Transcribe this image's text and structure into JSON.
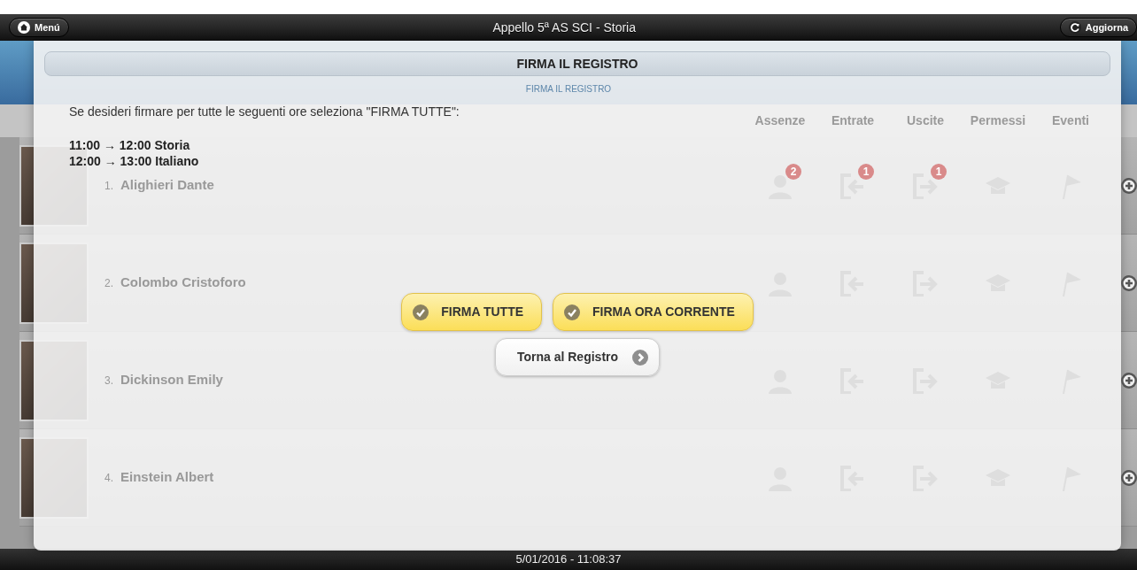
{
  "header": {
    "menu_button": "Menú",
    "title": "Appello 5ª AS SCI - Storia",
    "refresh_button": "Aggiorna"
  },
  "subtitle": "FIRMA IL REGISTRO",
  "columns": [
    "Assenze",
    "Entrate",
    "Uscite",
    "Permessi",
    "Eventi"
  ],
  "students": [
    {
      "number": "1.",
      "name": "Alighieri Dante",
      "icons": [
        {
          "kind": "absence",
          "badge": "2"
        },
        {
          "kind": "entry",
          "badge": "1"
        },
        {
          "kind": "exit",
          "badge": "1"
        },
        {
          "kind": "permit"
        },
        {
          "kind": "event"
        }
      ]
    },
    {
      "number": "2.",
      "name": "Colombo Cristoforo",
      "icons": [
        {
          "kind": "absence"
        },
        {
          "kind": "entry"
        },
        {
          "kind": "exit"
        },
        {
          "kind": "permit"
        },
        {
          "kind": "event"
        }
      ]
    },
    {
      "number": "3.",
      "name": "Dickinson Emily",
      "icons": [
        {
          "kind": "absence"
        },
        {
          "kind": "entry"
        },
        {
          "kind": "exit"
        },
        {
          "kind": "permit"
        },
        {
          "kind": "event"
        }
      ]
    },
    {
      "number": "4.",
      "name": "Einstein Albert",
      "icons": [
        {
          "kind": "absence"
        },
        {
          "kind": "entry"
        },
        {
          "kind": "exit"
        },
        {
          "kind": "permit"
        },
        {
          "kind": "event"
        }
      ]
    }
  ],
  "dialog": {
    "title": "FIRMA IL REGISTRO",
    "message": "Se desideri firmare per tutte le seguenti ore seleziona \"FIRMA TUTTE\":",
    "hours": [
      "11:00 → 12:00 Storia",
      "12:00 → 13:00 Italiano"
    ],
    "buttons": [
      {
        "label": "FIRMA TUTTE",
        "kind": "sign"
      },
      {
        "label": "FIRMA ORA CORRENTE",
        "kind": "sign"
      },
      {
        "label": "Torna al Registro",
        "kind": "back"
      }
    ]
  },
  "footer": "5/01/2016 - 11:08:37"
}
